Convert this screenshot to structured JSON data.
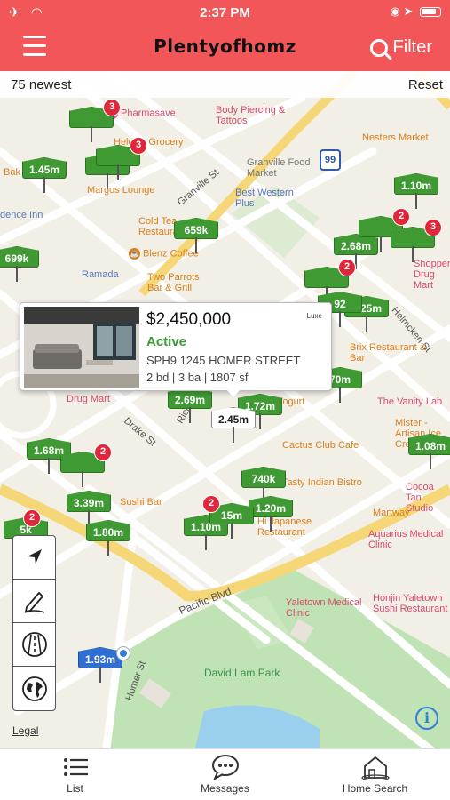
{
  "status_bar": {
    "time": "2:37 PM"
  },
  "header": {
    "logo": "Plentyofhomz",
    "filter_label": "Filter"
  },
  "subbar": {
    "count_label": "75 newest",
    "reset_label": "Reset"
  },
  "map": {
    "pois": [
      {
        "label": "Pharmasave",
        "color": "pink"
      },
      {
        "label": "Body Piercing & Tattoos",
        "color": "pink"
      },
      {
        "label": "Helen's Grocery",
        "color": "orange"
      },
      {
        "label": "Nesters Market",
        "color": "orange"
      },
      {
        "label": "Granville Food Market",
        "color": "gray"
      },
      {
        "label": "Margos Lounge",
        "color": "orange"
      },
      {
        "label": "Best Western Plus",
        "color": "blue"
      },
      {
        "label": "Cold Tea Restaurant",
        "color": "orange"
      },
      {
        "label": "Blenz Coffee",
        "color": "orange"
      },
      {
        "label": "Ramada",
        "color": "blue"
      },
      {
        "label": "Two Parrots Bar & Grill",
        "color": "orange"
      },
      {
        "label": "Brix Restaurant & Bar",
        "color": "orange"
      },
      {
        "label": "The Vanity Lab",
        "color": "pink"
      },
      {
        "label": "Mister - Artisan Ice Cream",
        "color": "orange"
      },
      {
        "label": "Drug Mart",
        "color": "pink"
      },
      {
        "label": "Cactus Club Cafe",
        "color": "orange"
      },
      {
        "label": "Tasty Indian Bistro",
        "color": "orange"
      },
      {
        "label": "Hi Japanese Restaurant",
        "color": "orange"
      },
      {
        "label": "Cocoa Tan Studio",
        "color": "pink"
      },
      {
        "label": "Martway",
        "color": "orange"
      },
      {
        "label": "Aquarius Medical Clinic",
        "color": "pink"
      },
      {
        "label": "Sushi Bar",
        "color": "orange"
      },
      {
        "label": "Yaletown Medical Clinic",
        "color": "pink"
      },
      {
        "label": "Honjin Yaletown Sushi Restaurant",
        "color": "pink"
      },
      {
        "label": "David Lam Park",
        "color": "green"
      },
      {
        "label": "Shoppers Drug Mart",
        "color": "pink"
      },
      {
        "label": "dence Inn",
        "color": "blue"
      },
      {
        "label": "Bak",
        "color": "orange"
      },
      {
        "label": "Yogurt",
        "color": "orange"
      }
    ],
    "streets": [
      "Granville St",
      "Richards St",
      "Drake St",
      "Pacific Blvd",
      "Homer St",
      "Helmcken St"
    ],
    "highway_shield": "99",
    "pins": [
      {
        "label": "",
        "badge": "3"
      },
      {
        "label": "",
        "badge": "2"
      },
      {
        "label": "",
        "badge": "3"
      },
      {
        "label": "1.45m",
        "badge": ""
      },
      {
        "label": "1.10m",
        "badge": ""
      },
      {
        "label": "659k",
        "badge": ""
      },
      {
        "label": "699k",
        "badge": ""
      },
      {
        "label": "2.68m",
        "badge": "2"
      },
      {
        "label": "",
        "badge": "3"
      },
      {
        "label": "",
        "badge": "2"
      },
      {
        "label": "1.25m",
        "badge": ""
      },
      {
        "label": "92",
        "badge": ""
      },
      {
        "label": "70m",
        "badge": ""
      },
      {
        "label": "2.69m",
        "badge": ""
      },
      {
        "label": "1.72m",
        "badge": ""
      },
      {
        "label": "2.45m",
        "badge": ""
      },
      {
        "label": "1.68m",
        "badge": ""
      },
      {
        "label": "",
        "badge": "2"
      },
      {
        "label": "1.08m",
        "badge": ""
      },
      {
        "label": "740k",
        "badge": ""
      },
      {
        "label": "3.39m",
        "badge": ""
      },
      {
        "label": "1.20m",
        "badge": ""
      },
      {
        "label": "1.80m",
        "badge": ""
      },
      {
        "label": "1.10m",
        "badge": ""
      },
      {
        "label": "15m",
        "badge": "2"
      },
      {
        "label": "5k",
        "badge": "2"
      },
      {
        "label": "1.93m",
        "badge": ""
      }
    ],
    "legal": "Legal",
    "info": "i"
  },
  "listing_popup": {
    "price": "$2,450,000",
    "status": "Active",
    "address": "SPH9 1245 HOMER STREET",
    "specs": "2 bd | 3 ba | 1807 sf",
    "broker_logo": "Luxe"
  },
  "tools": [
    "locate-icon",
    "draw-icon",
    "road-icon",
    "globe-icon"
  ],
  "tabs": [
    {
      "label": "List",
      "icon": "list-icon"
    },
    {
      "label": "Messages",
      "icon": "messages-icon"
    },
    {
      "label": "Home Search",
      "icon": "home-search-icon"
    }
  ],
  "colors": {
    "brand": "#f25658",
    "pin_green": "#3f9a34",
    "pin_blue": "#2f6fd1",
    "badge_red": "#e0263a",
    "status_green": "#3a9a3a"
  }
}
